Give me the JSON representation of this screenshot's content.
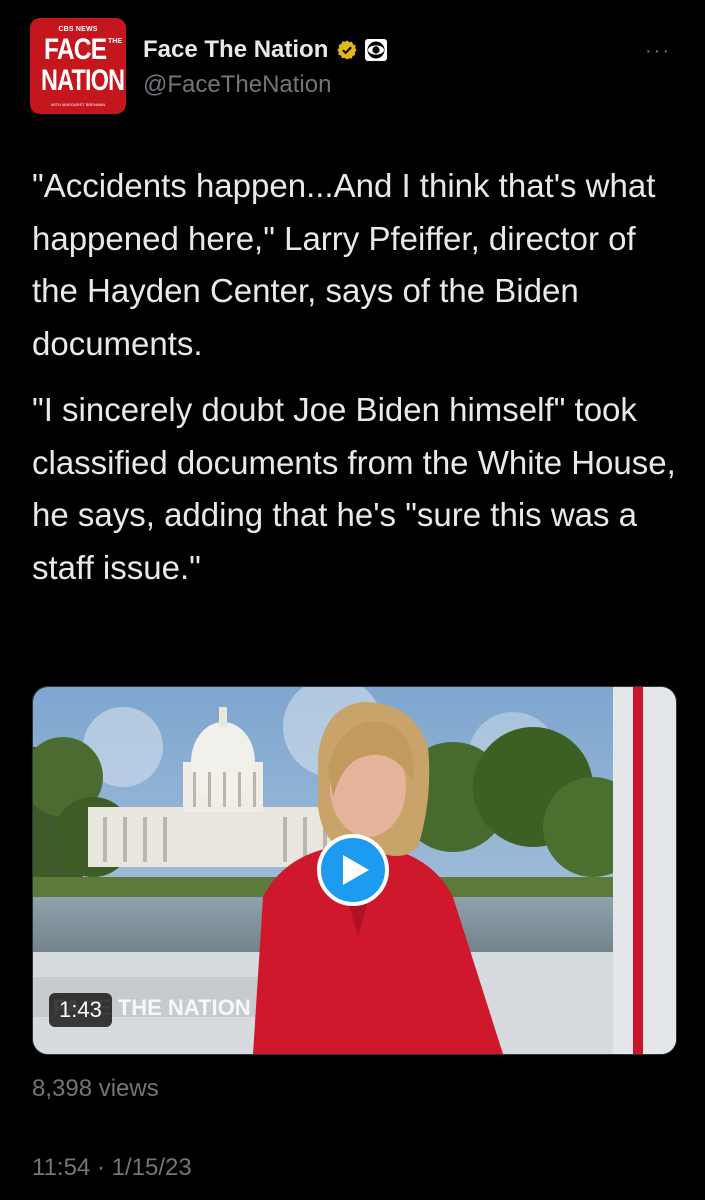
{
  "avatar": {
    "network": "CBS NEWS",
    "face": "FACE",
    "the": "THE",
    "nation": "NATION",
    "with": "WITH MARGARET BRENNAN"
  },
  "header": {
    "display_name": "Face The Nation",
    "handle": "@FaceTheNation",
    "verified_icon": "verified-badge-icon",
    "affiliate_icon": "cbs-eye-icon",
    "more_label": "···"
  },
  "tweet": {
    "paragraphs": [
      "\"Accidents happen...And I think that's what happened here,\" Larry Pfeiffer, director of the Hayden Center, says of the Biden documents.",
      "\"I sincerely doubt Joe Biden himself\" took classified documents from the White House, he says, adding that he's \"sure this was a staff issue.\""
    ]
  },
  "media": {
    "duration": "1:43",
    "overlay_logo": "FACE THE NATION",
    "play_icon": "play-icon"
  },
  "stats": {
    "views": "8,398 views",
    "timestamp": "11:54 · 1/15/23"
  },
  "colors": {
    "background": "#000000",
    "text": "#e7e9ea",
    "muted": "#71767b",
    "accent": "#1d9bf0",
    "verified_gold": "#e2b719",
    "brand_red": "#c4161c"
  }
}
